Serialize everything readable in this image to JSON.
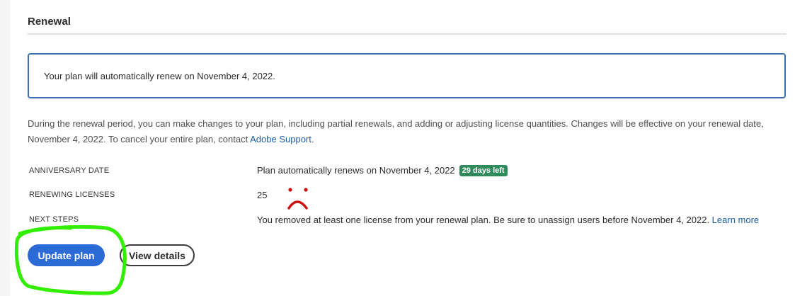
{
  "renewal": {
    "title": "Renewal",
    "notice": "Your plan will automatically renew on November 4, 2022.",
    "description_text": "During the renewal period, you can make changes to your plan, including partial renewals, and adding or adjusting license quantities. Changes will be effective on your renewal date, November 4, 2022. To cancel your entire plan, contact ",
    "description_link": "Adobe Support",
    "description_end": ".",
    "rows": {
      "anniversary": {
        "label": "ANNIVERSARY DATE",
        "value": "Plan automatically renews on November 4, 2022",
        "badge": "29 days left"
      },
      "licenses": {
        "label": "RENEWING LICENSES",
        "value": "25"
      },
      "next_steps": {
        "label": "NEXT STEPS",
        "value": "You removed at least one license from your renewal plan. Be sure to unassign users before November 4, 2022. ",
        "link": "Learn more"
      }
    },
    "buttons": {
      "update": "Update plan",
      "details": "View details"
    }
  },
  "colors": {
    "primary_button": "#2c6ad6",
    "badge": "#2f8a5c",
    "notice_border": "#3a6fae",
    "annotation_green": "#33ee00",
    "annotation_red": "#cc1111"
  },
  "annotations": {
    "sad_face": "sad-face-doodle",
    "highlight": "green-circle-around-update-button"
  }
}
